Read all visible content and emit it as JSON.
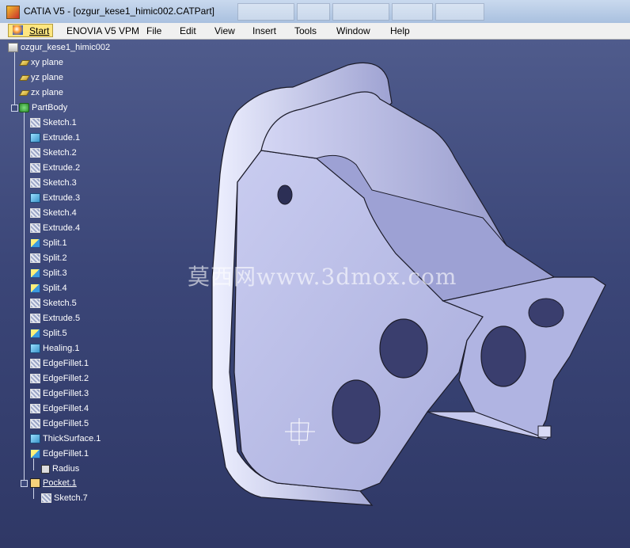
{
  "window": {
    "title": "CATIA V5 - [ozgur_kese1_himic002.CATPart]"
  },
  "menubar": {
    "items": [
      {
        "key": "start",
        "label": "Start"
      },
      {
        "key": "enovia",
        "label": "ENOVIA V5 VPM"
      },
      {
        "key": "file",
        "label": "File"
      },
      {
        "key": "edit",
        "label": "Edit"
      },
      {
        "key": "view",
        "label": "View"
      },
      {
        "key": "insert",
        "label": "Insert"
      },
      {
        "key": "tools",
        "label": "Tools"
      },
      {
        "key": "window",
        "label": "Window"
      },
      {
        "key": "help",
        "label": "Help"
      }
    ]
  },
  "tree": {
    "root": "ozgur_kese1_himic002",
    "planes": [
      "xy plane",
      "yz plane",
      "zx plane"
    ],
    "body": "PartBody",
    "features": [
      {
        "label": "Sketch.1",
        "icon": "sketch-icon"
      },
      {
        "label": "Extrude.1",
        "icon": "extrude-icon"
      },
      {
        "label": "Sketch.2",
        "icon": "sketch-icon"
      },
      {
        "label": "Extrude.2",
        "icon": "extrude-icon"
      },
      {
        "label": "Sketch.3",
        "icon": "sketch-icon"
      },
      {
        "label": "Extrude.3",
        "icon": "extrude-icon"
      },
      {
        "label": "Sketch.4",
        "icon": "sketch-icon"
      },
      {
        "label": "Extrude.4",
        "icon": "extrude-icon"
      },
      {
        "label": "Split.1",
        "icon": "split-icon"
      },
      {
        "label": "Split.2",
        "icon": "sketch-icon"
      },
      {
        "label": "Split.3",
        "icon": "split-icon"
      },
      {
        "label": "Split.4",
        "icon": "split-icon"
      },
      {
        "label": "Sketch.5",
        "icon": "sketch-icon"
      },
      {
        "label": "Extrude.5",
        "icon": "extrude-icon"
      },
      {
        "label": "Split.5",
        "icon": "split-icon"
      },
      {
        "label": "Healing.1",
        "icon": "healing-icon"
      },
      {
        "label": "EdgeFillet.1",
        "icon": "fillet-icon"
      },
      {
        "label": "EdgeFillet.2",
        "icon": "fillet-icon"
      },
      {
        "label": "EdgeFillet.3",
        "icon": "fillet-icon"
      },
      {
        "label": "EdgeFillet.4",
        "icon": "fillet-icon"
      },
      {
        "label": "EdgeFillet.5",
        "icon": "fillet-icon"
      },
      {
        "label": "ThickSurface.1",
        "icon": "thicksurface-icon"
      },
      {
        "label": "EdgeFillet.1",
        "icon": "fillet-icon"
      },
      {
        "label": "Radius",
        "icon": "parameter-icon"
      },
      {
        "label": "Pocket.1",
        "icon": "pocket-icon"
      },
      {
        "label": "Sketch.7",
        "icon": "sketch-icon"
      }
    ]
  },
  "watermark": "莫西网www.3dmox.com",
  "colors": {
    "background_top": "#4f5b8c",
    "background_bottom": "#2f3866",
    "part_face": "#b9bde6",
    "part_edge": "#1c1c2a",
    "start_highlight": "#ffe680"
  }
}
